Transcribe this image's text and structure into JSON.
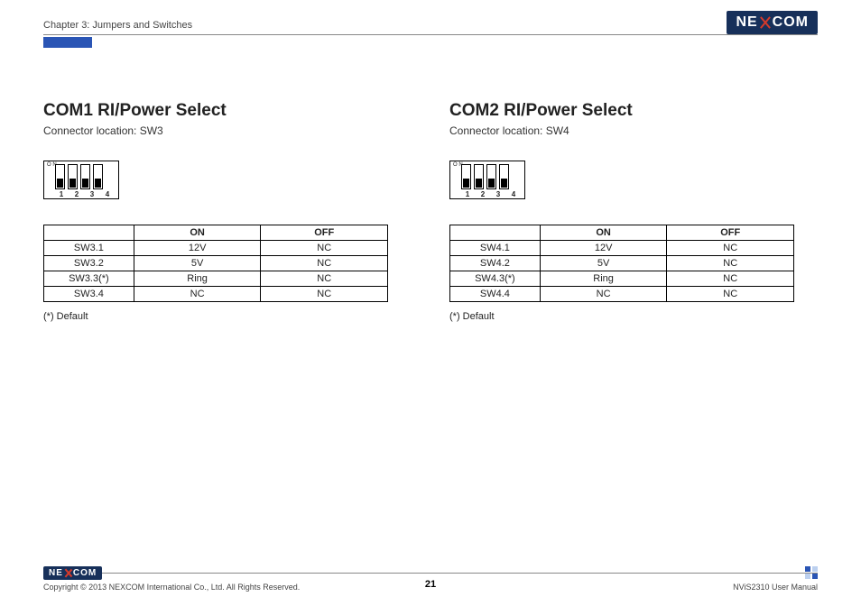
{
  "header": {
    "chapter": "Chapter 3: Jumpers and Switches",
    "brand": "NEXCOM"
  },
  "sections": [
    {
      "title": "COM1 RI/Power Select",
      "subtitle": "Connector location: SW3",
      "dip": {
        "label_on": "O N",
        "positions": [
          "down",
          "down",
          "down",
          "down"
        ],
        "numbers": [
          "1",
          "2",
          "3",
          "4"
        ]
      },
      "table": {
        "head": [
          "",
          "ON",
          "OFF"
        ],
        "rows": [
          [
            "SW3.1",
            "12V",
            "NC"
          ],
          [
            "SW3.2",
            "5V",
            "NC"
          ],
          [
            "SW3.3(*)",
            "Ring",
            "NC"
          ],
          [
            "SW3.4",
            "NC",
            "NC"
          ]
        ]
      },
      "default_note": "(*) Default"
    },
    {
      "title": "COM2 RI/Power Select",
      "subtitle": "Connector location: SW4",
      "dip": {
        "label_on": "O N",
        "positions": [
          "down",
          "down",
          "down",
          "down"
        ],
        "numbers": [
          "1",
          "2",
          "3",
          "4"
        ]
      },
      "table": {
        "head": [
          "",
          "ON",
          "OFF"
        ],
        "rows": [
          [
            "SW4.1",
            "12V",
            "NC"
          ],
          [
            "SW4.2",
            "5V",
            "NC"
          ],
          [
            "SW4.3(*)",
            "Ring",
            "NC"
          ],
          [
            "SW4.4",
            "NC",
            "NC"
          ]
        ]
      },
      "default_note": "(*) Default"
    }
  ],
  "footer": {
    "copyright": "Copyright © 2013 NEXCOM International Co., Ltd. All Rights Reserved.",
    "page": "21",
    "doc": "NViS2310 User Manual"
  }
}
